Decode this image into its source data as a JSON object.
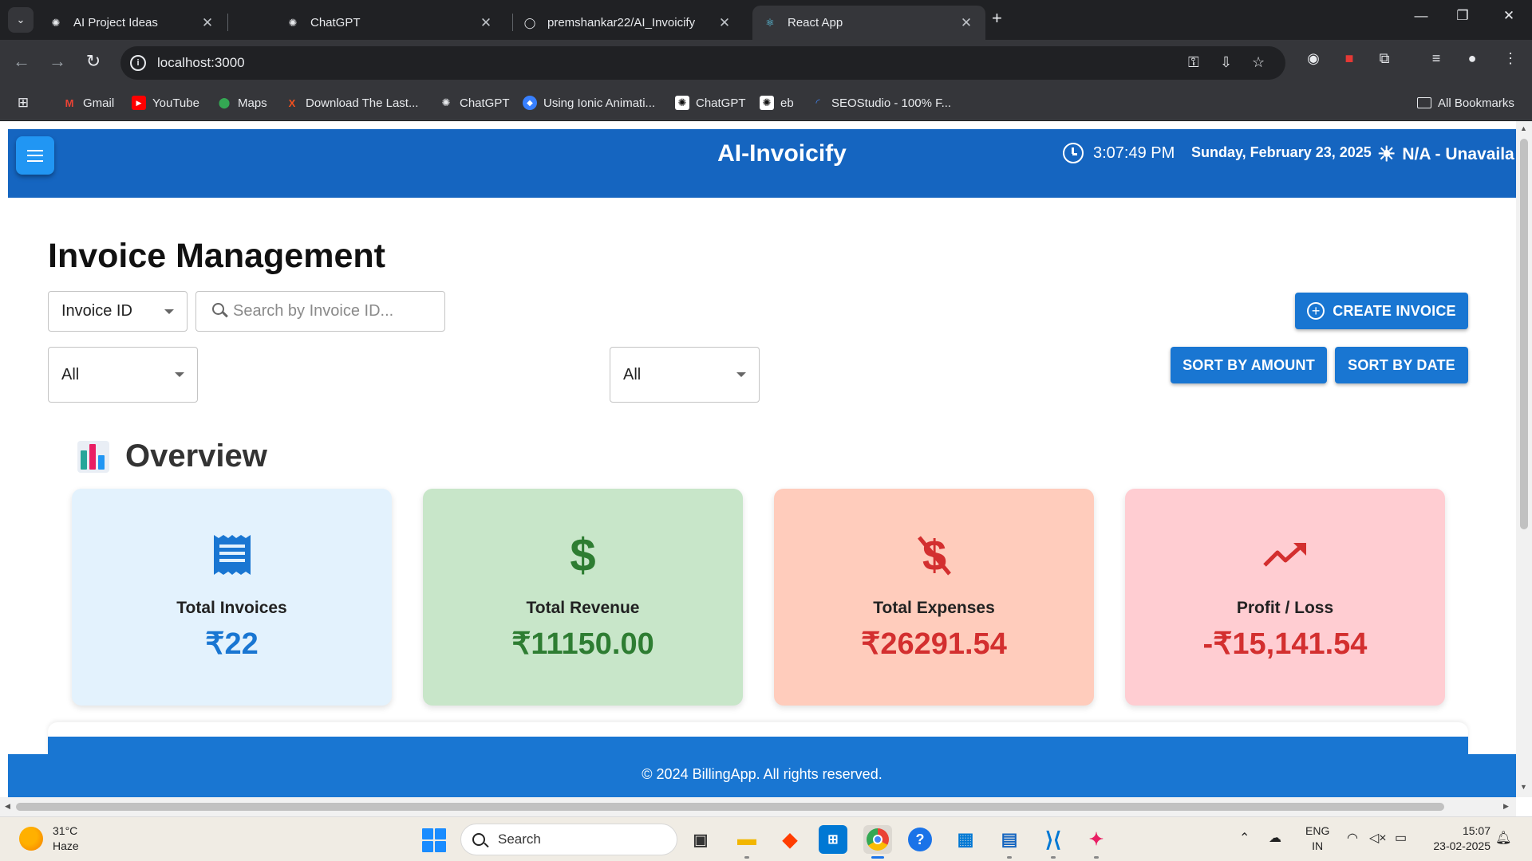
{
  "browser": {
    "tabs": [
      {
        "title": "AI Project Ideas",
        "icon": "chatgpt-icon",
        "active": false
      },
      {
        "title": "ChatGPT",
        "icon": "chatgpt-icon",
        "active": false
      },
      {
        "title": "premshankar22/AI_Invoicify",
        "icon": "github-icon",
        "active": false
      },
      {
        "title": "React App",
        "icon": "react-icon",
        "active": true
      }
    ],
    "url": "localhost:3000",
    "bookmarks": [
      {
        "label": "Gmail",
        "icon": "gmail-icon"
      },
      {
        "label": "YouTube",
        "icon": "youtube-icon"
      },
      {
        "label": "Maps",
        "icon": "maps-icon"
      },
      {
        "label": "Download The Last...",
        "icon": "x-icon"
      },
      {
        "label": "ChatGPT",
        "icon": "chatgpt-icon"
      },
      {
        "label": "Using Ionic Animati...",
        "icon": "ionic-icon"
      },
      {
        "label": "ChatGPT",
        "icon": "chatgpt-icon"
      },
      {
        "label": "eb",
        "icon": "chatgpt-icon"
      },
      {
        "label": "SEOStudio - 100% F...",
        "icon": "seostudio-icon"
      }
    ],
    "all_bookmarks_label": "All Bookmarks"
  },
  "app": {
    "title": "AI-Invoicify",
    "time": "3:07:49 PM",
    "date": "Sunday, February 23, 2025",
    "weather": "N/A - Unavaila",
    "page_title": "Invoice Management",
    "search": {
      "field_select": "Invoice ID",
      "placeholder": "Search by Invoice ID..."
    },
    "filters": {
      "filter_one": "All",
      "filter_two": "All"
    },
    "buttons": {
      "create": "CREATE INVOICE",
      "sort_amount": "SORT BY AMOUNT",
      "sort_date": "SORT BY DATE"
    },
    "overview": {
      "title": "Overview",
      "cards": [
        {
          "label": "Total Invoices",
          "value": "₹22",
          "icon": "receipt-icon",
          "bg": "#e3f2fd",
          "color": "#1976d2"
        },
        {
          "label": "Total Revenue",
          "value": "₹11150.00",
          "icon": "dollar-icon",
          "bg": "#c8e6c9",
          "color": "#2e7d32"
        },
        {
          "label": "Total Expenses",
          "value": "₹26291.54",
          "icon": "money-off-icon",
          "bg": "#ffccbc",
          "color": "#d32f2f"
        },
        {
          "label": "Profit / Loss",
          "value": "-₹15,141.54",
          "icon": "trending-up-icon",
          "bg": "#ffcdd2",
          "color": "#d32f2f"
        }
      ]
    },
    "footer": "© 2024 BillingApp. All rights reserved."
  },
  "taskbar": {
    "weather_temp": "31°C",
    "weather_desc": "Haze",
    "search_label": "Search",
    "lang_line1": "ENG",
    "lang_line2": "IN",
    "time": "15:07",
    "date": "23-02-2025"
  },
  "colors": {
    "header": "#1565c0",
    "primary": "#1976d2",
    "footer": "#1976d2"
  }
}
